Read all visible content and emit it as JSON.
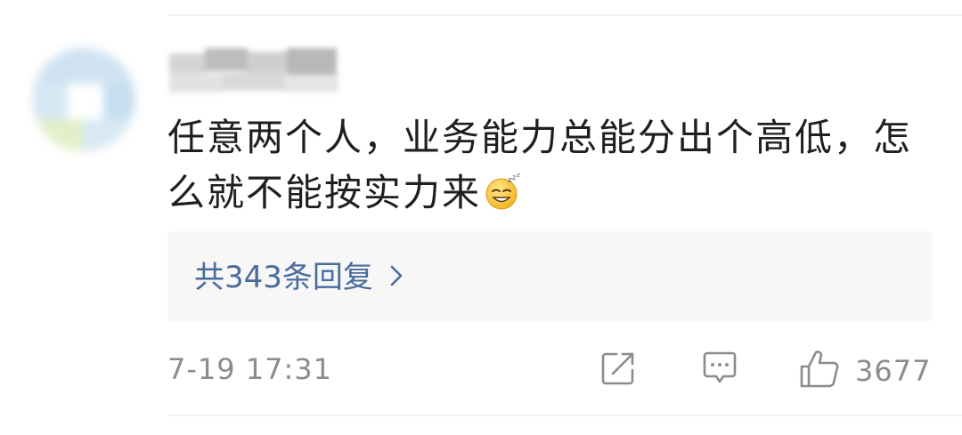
{
  "comment": {
    "text_line1": "任意两个人，业务能力总能分出个高低，怎",
    "text_line2": "么就不能按实力来",
    "emoji": "sleepy-grin-emoji"
  },
  "replies": {
    "label": "共343条回复"
  },
  "meta": {
    "timestamp": "7-19 17:31",
    "like_count": "3677"
  },
  "icons": {
    "share": "share-icon",
    "comment": "comment-icon",
    "like": "thumbs-up-icon",
    "chevron": "chevron-right-icon"
  },
  "colors": {
    "link": "#4a6c9b",
    "meta_text": "#8c8c8c",
    "body_text": "#1f1f1f",
    "reply_bg": "#f7f7f7"
  }
}
